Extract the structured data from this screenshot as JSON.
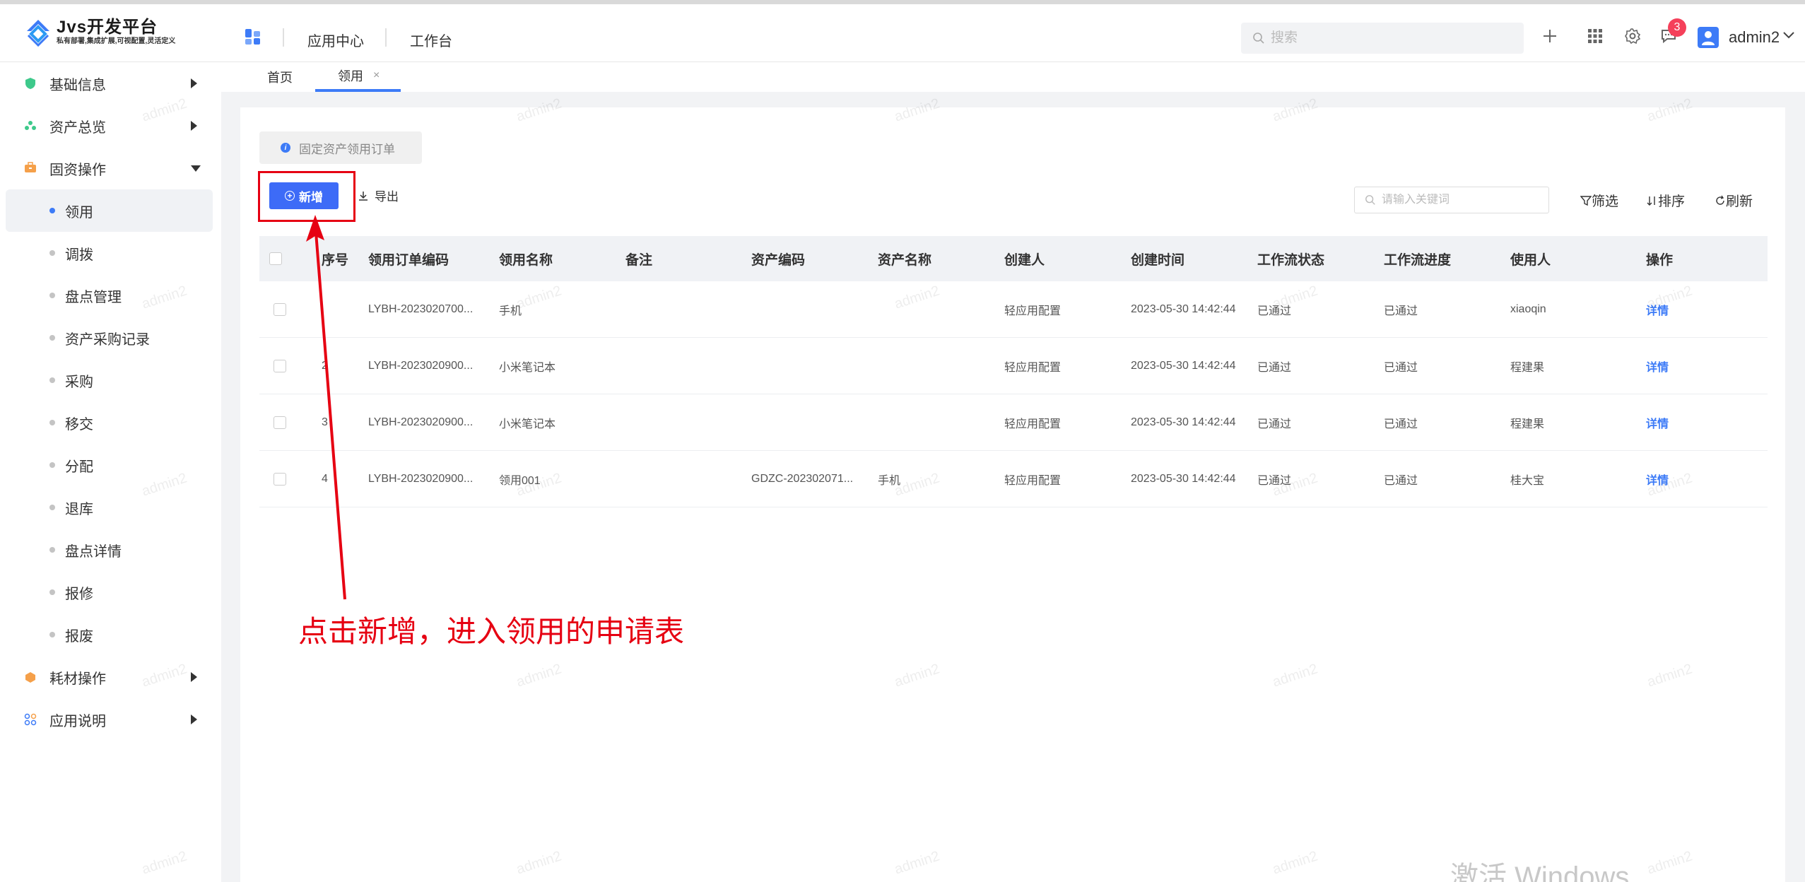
{
  "app": {
    "logo_title": "Jvs开发平台",
    "logo_subtitle": "私有部署,集成扩展,可视配置,灵活定义"
  },
  "header": {
    "nav": [
      "应用中心",
      "工作台"
    ],
    "search_placeholder": "搜索",
    "notification_count": "3",
    "user_name": "admin2"
  },
  "sidebar": {
    "items": [
      {
        "label": "基础信息"
      },
      {
        "label": "资产总览"
      },
      {
        "label": "固资操作"
      },
      {
        "label": "耗材操作"
      },
      {
        "label": "应用说明"
      }
    ],
    "sub_items": [
      "领用",
      "调拨",
      "盘点管理",
      "资产采购记录",
      "采购",
      "移交",
      "分配",
      "退库",
      "盘点详情",
      "报修",
      "报废"
    ]
  },
  "tabs": [
    {
      "label": "首页"
    },
    {
      "label": "领用",
      "close": "×"
    }
  ],
  "toolbar": {
    "info_chip": "固定资产领用订单",
    "add_label": "新增",
    "export_label": "导出",
    "keyword_placeholder": "请输入关键词",
    "filter_label": "筛选",
    "sort_label": "排序",
    "refresh_label": "刷新"
  },
  "table": {
    "columns": [
      "序号",
      "领用订单编码",
      "领用名称",
      "备注",
      "资产编码",
      "资产名称",
      "创建人",
      "创建时间",
      "工作流状态",
      "工作流进度",
      "使用人",
      "操作"
    ],
    "rows": [
      {
        "no": "",
        "code": "LYBH-2023020700...",
        "name": "手机",
        "remark": "",
        "asset_code": "",
        "asset_name": "",
        "creator": "轻应用配置",
        "created": "2023-05-30 14:42:44",
        "wf_status": "已通过",
        "wf_progress": "已通过",
        "user": "xiaoqin",
        "action": "详情"
      },
      {
        "no": "2",
        "code": "LYBH-2023020900...",
        "name": "小米笔记本",
        "remark": "",
        "asset_code": "",
        "asset_name": "",
        "creator": "轻应用配置",
        "created": "2023-05-30 14:42:44",
        "wf_status": "已通过",
        "wf_progress": "已通过",
        "user": "程建果",
        "action": "详情"
      },
      {
        "no": "3",
        "code": "LYBH-2023020900...",
        "name": "小米笔记本",
        "remark": "",
        "asset_code": "",
        "asset_name": "",
        "creator": "轻应用配置",
        "created": "2023-05-30 14:42:44",
        "wf_status": "已通过",
        "wf_progress": "已通过",
        "user": "程建果",
        "action": "详情"
      },
      {
        "no": "4",
        "code": "LYBH-2023020900...",
        "name": "领用001",
        "remark": "",
        "asset_code": "GDZC-202302071...",
        "asset_name": "手机",
        "creator": "轻应用配置",
        "created": "2023-05-30 14:42:44",
        "wf_status": "已通过",
        "wf_progress": "已通过",
        "user": "桂大宝",
        "action": "详情"
      }
    ]
  },
  "annotation": "点击新增，进入领用的申请表",
  "watermark": "admin2",
  "windows_watermark": "激活 Windows",
  "colors": {
    "accent": "#3d7bf7",
    "annotation": "#e60012"
  }
}
